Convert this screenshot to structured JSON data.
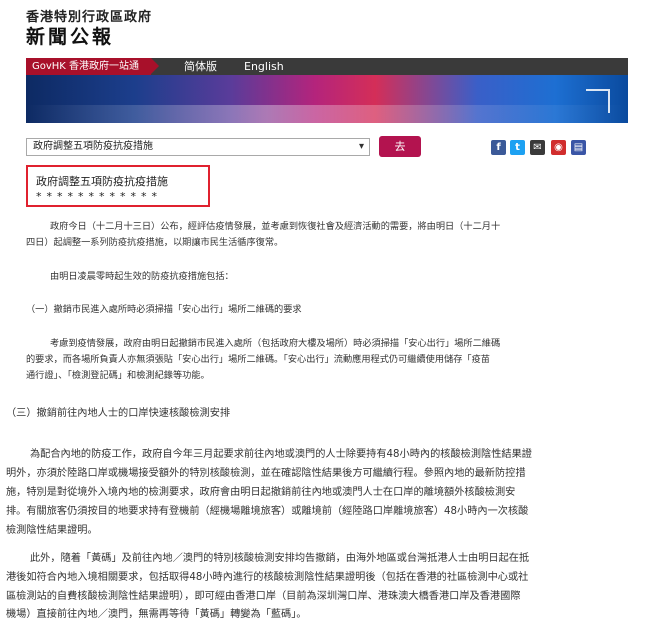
{
  "header": {
    "govt_name": "香港特別行政區政府",
    "site_title": "新聞公報"
  },
  "nav": {
    "govhk": "GovHK 香港政府一站通",
    "simplified": "简体版",
    "english": "English"
  },
  "toolbar": {
    "select_value": "政府調整五項防疫抗疫措施",
    "go_label": "去",
    "share_icons": [
      "facebook-icon",
      "twitter-icon",
      "email-icon",
      "weibo-icon",
      "print-icon"
    ],
    "share_colors": [
      "#3b5998",
      "#1da1f2",
      "#3a3a3a",
      "#d12d2d",
      "#3a55a6"
    ]
  },
  "article": {
    "title": "政府調整五項防疫抗疫措施",
    "stars": "************",
    "p1_l1": "政府今日（十二月十三日）公布，經評估疫情發展，並考慮到恢復社會及經濟活動的需要，將由明日（十二月十",
    "p1_l2": "四日）起調整一系列防疫抗疫措施，以期讓市民生活循序復常。",
    "p2": "由明日凌晨零時起生效的防疫抗疫措施包括：",
    "h1": "（一）撤銷市民進入處所時必須掃描「安心出行」場所二維碼的要求",
    "p3_l1": "考慮到疫情發展，政府由明日起撤銷市民進入處所（包括政府大樓及場所）時必須掃描「安心出行」場所二維碼",
    "p3_l2": "的要求，而各場所負責人亦無須張貼「安心出行」場所二維碼。「安心出行」流動應用程式仍可繼續使用儲存「疫苗",
    "p3_l3": "通行證」、「檢測登記碼」和檢測紀錄等功能。",
    "h3": "（三）撤銷前往內地人士的口岸快速核酸檢測安排",
    "p4_l1": "為配合內地的防疫工作，政府自今年三月起要求前往內地或澳門的人士除要持有48小時內的核酸檢測陰性結果證",
    "p4_l2": "明外，亦須於陸路口岸或機場接受額外的特別核酸檢測，並在確認陰性結果後方可繼續行程。參照內地的最新防控措",
    "p4_l3": "施，特別是對從境外入境內地的檢測要求，政府會由明日起撤銷前往內地或澳門人士在口岸的離境額外核酸檢測安",
    "p4_l4": "排。有關旅客仍須按目的地要求持有登機前（經機場離境旅客）或離境前（經陸路口岸離境旅客）48小時內一次核酸",
    "p4_l5": "檢測陰性結果證明。",
    "p5_l1": "此外，隨着「黃碼」及前往內地／澳門的特別核酸檢測安排均告撤銷，由海外地區或台灣抵港人士由明日起在抵",
    "p5_l2": "港後如符合內地入境相關要求，包括取得48小時內進行的核酸檢測陰性結果證明後（包括在香港的社區檢測中心或社",
    "p5_l3": "區檢測站的自費核酸檢測陰性結果證明），即可經由香港口岸（目前為深圳灣口岸、港珠澳大橋香港口岸及香港國際",
    "p5_l4": "機場）直接前往內地／澳門，無需再等待「黃碼」轉變為「藍碼」。"
  }
}
